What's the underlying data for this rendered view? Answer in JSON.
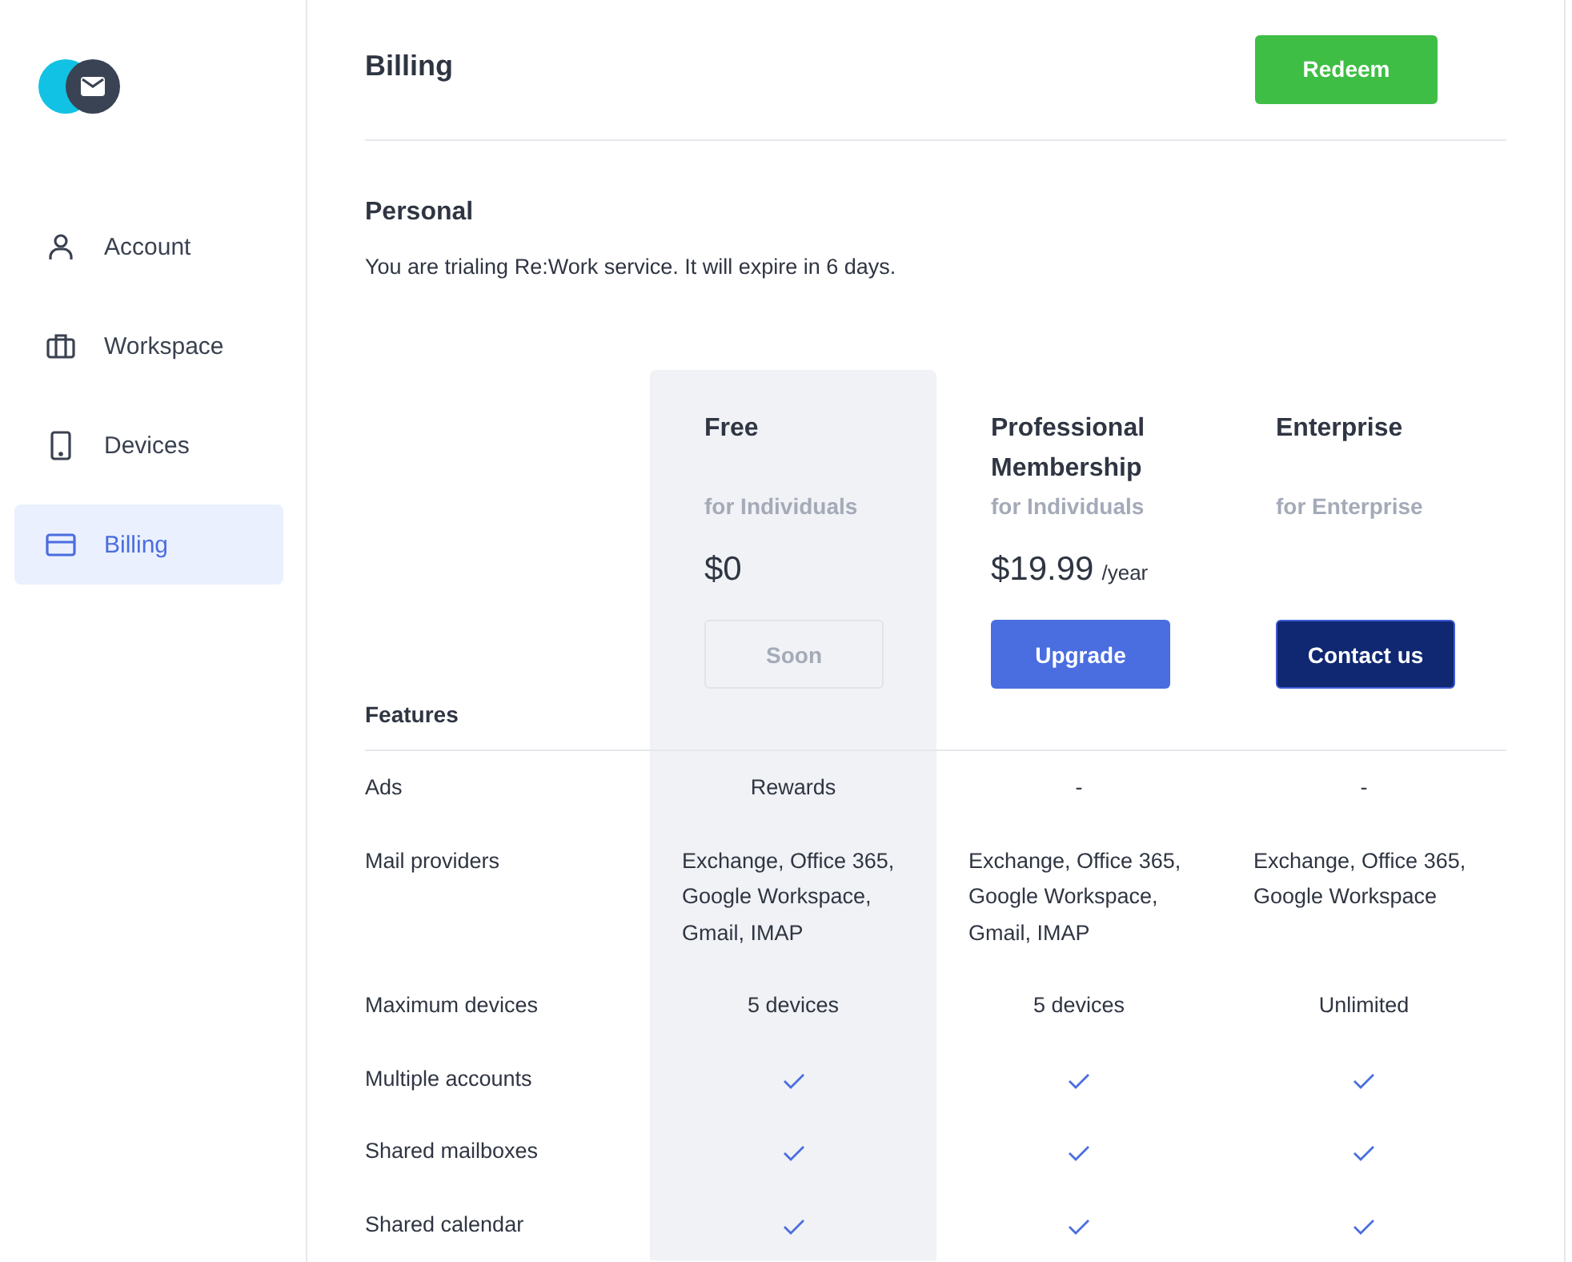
{
  "sidebar": {
    "items": [
      {
        "label": "Account",
        "selected": false
      },
      {
        "label": "Workspace",
        "selected": false
      },
      {
        "label": "Devices",
        "selected": false
      },
      {
        "label": "Billing",
        "selected": true
      }
    ]
  },
  "header": {
    "title": "Billing",
    "button": "Redeem"
  },
  "section": {
    "title": "Personal",
    "message": "You are trialing Re:Work service. It will expire in 6 days."
  },
  "plans": [
    {
      "name": "Free",
      "audience": "for Individuals",
      "price": "$0",
      "selected": true,
      "button": {
        "label": "Soon",
        "disabled": true
      }
    },
    {
      "name": "Professional Membership",
      "audience": "for Individuals",
      "price": "$19.99",
      "period": "/year",
      "selected": false,
      "button": {
        "label": "Upgrade",
        "disabled": false
      }
    },
    {
      "name": "Enterprise",
      "audience": "for Enterprise",
      "selected": false,
      "button": {
        "label": "Contact us",
        "disabled": false
      }
    }
  ],
  "features_heading": "Features",
  "features": [
    {
      "name": "Ads",
      "cells": [
        {
          "kind": "text",
          "text": "Rewards"
        },
        {
          "kind": "text",
          "text": "-"
        },
        {
          "kind": "text",
          "text": "-"
        }
      ]
    },
    {
      "name": "Mail providers",
      "cells": [
        {
          "kind": "list",
          "text": "Exchange, Office 365, Google Workspace, Gmail, IMAP"
        },
        {
          "kind": "list",
          "text": "Exchange, Office 365, Google Workspace, Gmail, IMAP"
        },
        {
          "kind": "list",
          "text": "Exchange, Office 365, Google Workspace"
        }
      ]
    },
    {
      "name": "Maximum devices",
      "cells": [
        {
          "kind": "text",
          "text": "5 devices"
        },
        {
          "kind": "text",
          "text": "5 devices"
        },
        {
          "kind": "text",
          "text": "Unlimited"
        }
      ]
    },
    {
      "name": "Multiple accounts",
      "cells": [
        {
          "kind": "check",
          "checked": true
        },
        {
          "kind": "check",
          "checked": true
        },
        {
          "kind": "check",
          "checked": true
        }
      ]
    },
    {
      "name": "Shared mailboxes",
      "cells": [
        {
          "kind": "check",
          "checked": true
        },
        {
          "kind": "check",
          "checked": true
        },
        {
          "kind": "check",
          "checked": true
        }
      ]
    },
    {
      "name": "Shared calendar",
      "cells": [
        {
          "kind": "check",
          "checked": true
        },
        {
          "kind": "check",
          "checked": true
        },
        {
          "kind": "check",
          "checked": true
        }
      ]
    }
  ]
}
